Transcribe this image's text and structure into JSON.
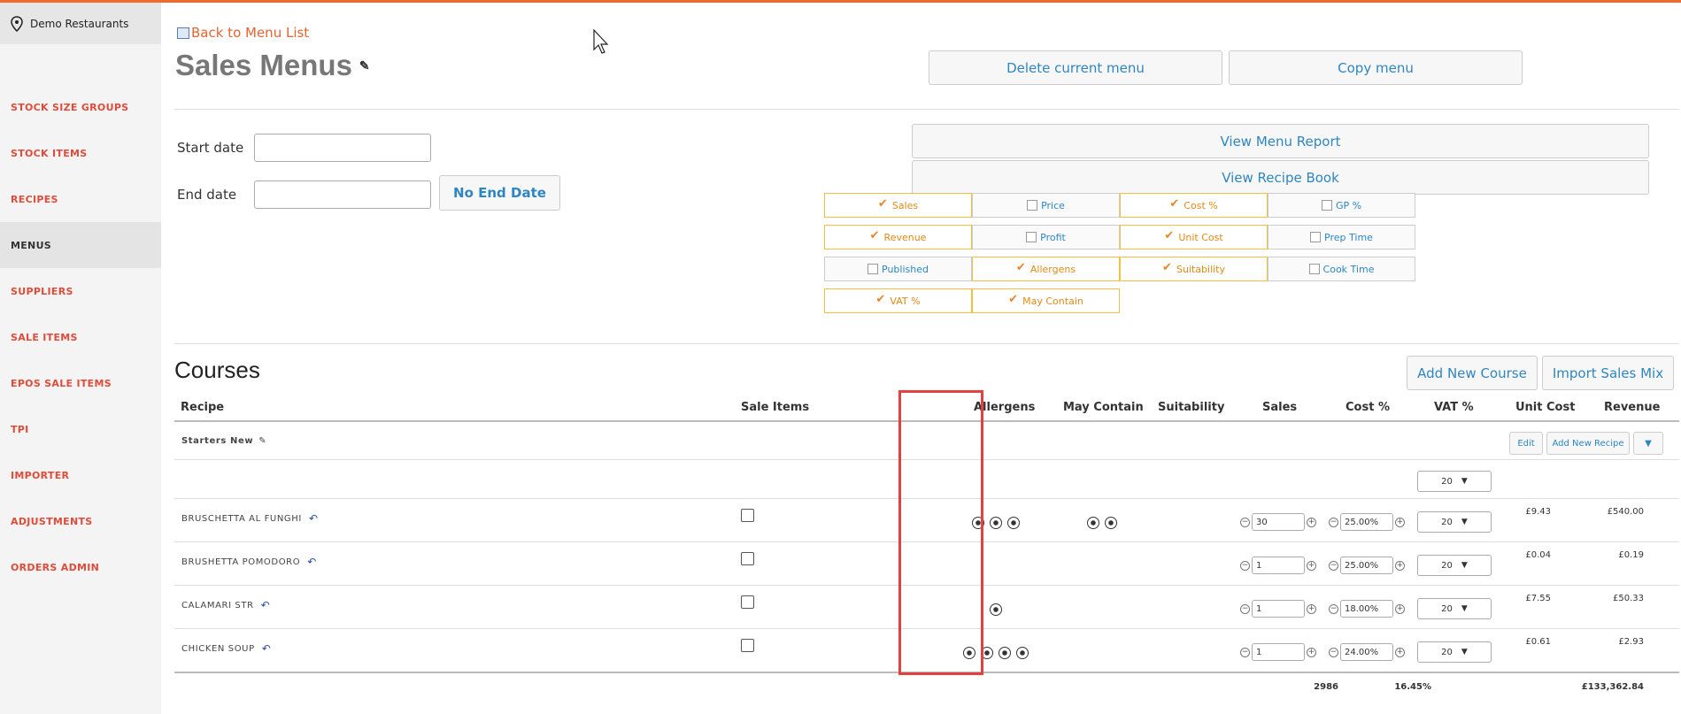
{
  "sidebar": {
    "brand": "Demo Restaurants",
    "items": [
      {
        "label": "STOCK SIZE GROUPS"
      },
      {
        "label": "STOCK ITEMS"
      },
      {
        "label": "RECIPES"
      },
      {
        "label": "MENUS"
      },
      {
        "label": "SUPPLIERS"
      },
      {
        "label": "SALE ITEMS"
      },
      {
        "label": "EPOS SALE ITEMS"
      },
      {
        "label": "TPI"
      },
      {
        "label": "IMPORTER"
      },
      {
        "label": "ADJUSTMENTS"
      },
      {
        "label": "ORDERS ADMIN"
      }
    ]
  },
  "header": {
    "back_link": "Back to Menu List",
    "title": "Sales Menus",
    "delete_label": "Delete current menu",
    "copy_label": "Copy menu"
  },
  "dates": {
    "start_label": "Start date",
    "end_label": "End date",
    "start_value": "",
    "end_value": "",
    "no_end_label": "No End Date"
  },
  "reports": {
    "menu_report": "View Menu Report",
    "recipe_book": "View Recipe Book"
  },
  "columns": [
    {
      "label": "Sales",
      "checked": true
    },
    {
      "label": "Price",
      "checked": false
    },
    {
      "label": "Cost %",
      "checked": true
    },
    {
      "label": "GP %",
      "checked": false
    },
    {
      "label": "Revenue",
      "checked": true
    },
    {
      "label": "Profit",
      "checked": false
    },
    {
      "label": "Unit Cost",
      "checked": true
    },
    {
      "label": "Prep Time",
      "checked": false
    },
    {
      "label": "Published",
      "checked": false
    },
    {
      "label": "Allergens",
      "checked": true
    },
    {
      "label": "Suitability",
      "checked": true
    },
    {
      "label": "Cook Time",
      "checked": false
    },
    {
      "label": "VAT %",
      "checked": true
    },
    {
      "label": "May Contain",
      "checked": true
    }
  ],
  "courses": {
    "heading": "Courses",
    "add_course": "Add New Course",
    "import_sales": "Import Sales Mix",
    "table_headers": [
      "Recipe",
      "Sale Items",
      "Allergens",
      "May Contain",
      "Suitability",
      "Sales",
      "Cost %",
      "VAT %",
      "Unit Cost",
      "Revenue"
    ],
    "group_name": "Starters New",
    "edit_label": "Edit",
    "add_recipe_label": "Add New Recipe",
    "dropdown_label": "▼",
    "group_vat": "20",
    "rows": [
      {
        "name": "BRUSCHETTA AL FUNGHI",
        "allergens": 3,
        "may_contain": 2,
        "sales": "30",
        "cost": "25.00%",
        "vat": "20",
        "unit_cost": "£9.43",
        "revenue": "£540.00"
      },
      {
        "name": "BRUSHETTA POMODORO",
        "allergens": 0,
        "may_contain": 0,
        "sales": "1",
        "cost": "25.00%",
        "vat": "20",
        "unit_cost": "£0.04",
        "revenue": "£0.19"
      },
      {
        "name": "CALAMARI STR",
        "allergens": 1,
        "may_contain": 0,
        "sales": "1",
        "cost": "18.00%",
        "vat": "20",
        "unit_cost": "£7.55",
        "revenue": "£50.33"
      },
      {
        "name": "CHICKEN SOUP",
        "allergens": 4,
        "may_contain": 0,
        "sales": "1",
        "cost": "24.00%",
        "vat": "20",
        "unit_cost": "£0.61",
        "revenue": "£2.93"
      }
    ],
    "totals": {
      "sales": "2986",
      "vat": "16.45%",
      "revenue": "£133,362.84"
    }
  },
  "colors": {
    "accent": "#f26a2a",
    "link": "#2e86c1",
    "nav": "#e04b3a",
    "highlight": "#e34040"
  }
}
